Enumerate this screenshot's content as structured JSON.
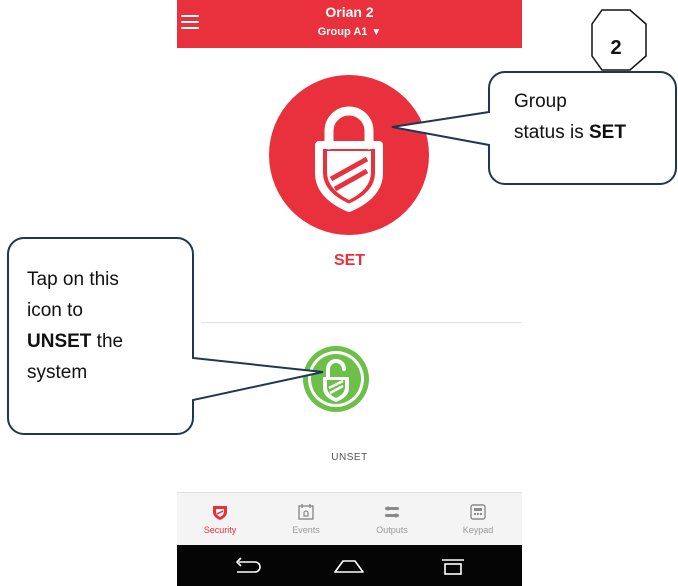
{
  "app": {
    "title": "Orian 2",
    "group_selector": "Group A1",
    "group_caret": "▼"
  },
  "status": {
    "state_label": "SET",
    "action_label": "UNSET"
  },
  "bottom_nav": {
    "items": [
      {
        "label": "Security",
        "icon": "shield-icon",
        "active": true
      },
      {
        "label": "Events",
        "icon": "calendar-bell-icon",
        "active": false
      },
      {
        "label": "Outputs",
        "icon": "sliders-icon",
        "active": false
      },
      {
        "label": "Keypad",
        "icon": "keypad-icon",
        "active": false
      }
    ]
  },
  "callouts": {
    "step_number": "2",
    "group_status": {
      "line1": "Group",
      "line2_prefix": "status is ",
      "line2_bold": "SET"
    },
    "tap_hint": {
      "line1": "Tap on this",
      "line2": "icon to",
      "line3_bold": "UNSET",
      "line3_suffix": " the",
      "line4": "system"
    }
  },
  "colors": {
    "brand_red": "#e8313d",
    "unset_green": "#6cc04a",
    "callout_border": "#1f3655"
  }
}
